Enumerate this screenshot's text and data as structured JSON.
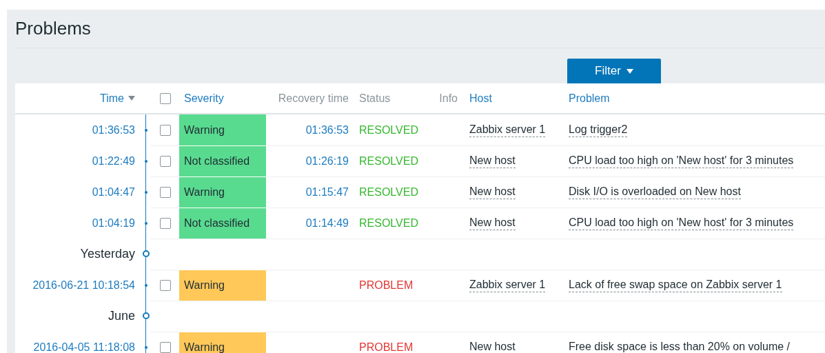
{
  "page": {
    "title": "Problems"
  },
  "filter_button": {
    "label": "Filter"
  },
  "table": {
    "select_all": {
      "checked": false
    },
    "columns": [
      {
        "label": "Time",
        "kind": "link",
        "sorted": true
      },
      {
        "label": "Severity",
        "kind": "link",
        "sorted": false
      },
      {
        "label": "Recovery time",
        "kind": "plain",
        "sorted": false
      },
      {
        "label": "Status",
        "kind": "plain",
        "sorted": false
      },
      {
        "label": "Info",
        "kind": "plain",
        "sorted": false
      },
      {
        "label": "Host",
        "kind": "link",
        "sorted": false
      },
      {
        "label": "Problem",
        "kind": "link",
        "sorted": false
      }
    ],
    "rows": [
      {
        "kind": "event",
        "time": "01:36:53",
        "checked": false,
        "severity": "Warning",
        "color": "#59db8f",
        "recovery_time": "01:36:53",
        "status": "RESOLVED",
        "resolved": true,
        "host": "Zabbix server 1",
        "problem": "Log trigger2"
      },
      {
        "kind": "event",
        "time": "01:22:49",
        "checked": false,
        "severity": "Not classified",
        "color": "#59db8f",
        "recovery_time": "01:26:19",
        "status": "RESOLVED",
        "resolved": true,
        "host": "New host",
        "problem": "CPU load too high on 'New host' for 3 minutes"
      },
      {
        "kind": "event",
        "time": "01:04:47",
        "checked": false,
        "severity": "Warning",
        "color": "#59db8f",
        "recovery_time": "01:15:47",
        "status": "RESOLVED",
        "resolved": true,
        "host": "New host",
        "problem": "Disk I/O is overloaded on New host"
      },
      {
        "kind": "event",
        "time": "01:04:19",
        "checked": false,
        "severity": "Not classified",
        "color": "#59db8f",
        "recovery_time": "01:14:49",
        "status": "RESOLVED",
        "resolved": true,
        "host": "New host",
        "problem": "CPU load too high on 'New host' for 3 minutes"
      },
      {
        "kind": "date",
        "label": "Yesterday"
      },
      {
        "kind": "event",
        "time": "2016-06-21 10:18:54",
        "checked": false,
        "severity": "Warning",
        "color": "#ffc859",
        "status": "PROBLEM",
        "resolved": false,
        "host": "Zabbix server 1",
        "problem": "Lack of free swap space on Zabbix server 1"
      },
      {
        "kind": "date",
        "label": "June"
      },
      {
        "kind": "event",
        "time": "2016-04-05 11:18:08",
        "checked": false,
        "severity": "Warning",
        "color": "#ffc859",
        "status": "PROBLEM",
        "resolved": false,
        "host": "New host",
        "problem": "Free disk space is less than 20% on volume /"
      }
    ]
  }
}
